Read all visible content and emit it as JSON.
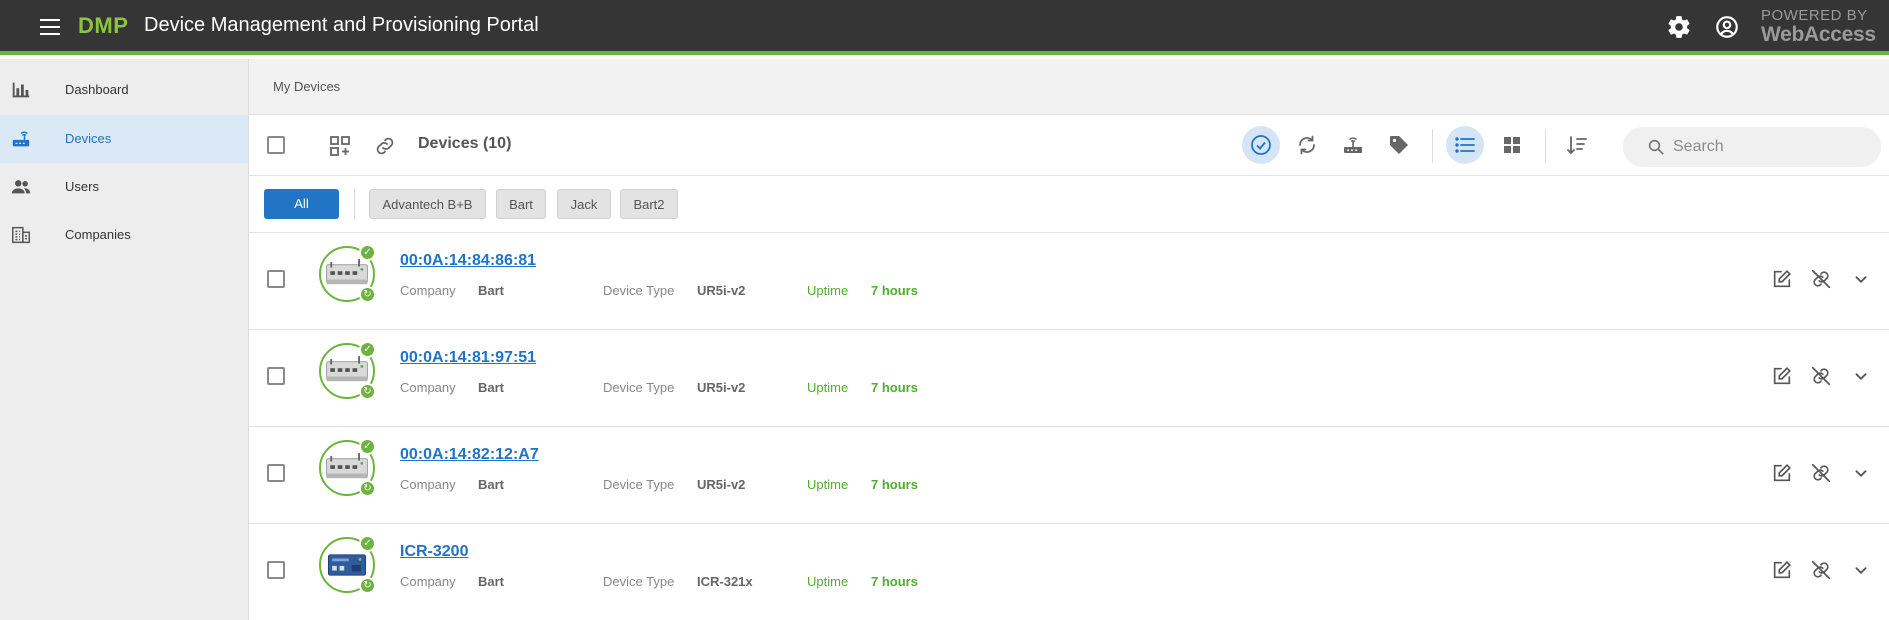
{
  "header": {
    "brand": "DMP",
    "title": "Device Management and Provisioning Portal",
    "powered_line1": "POWERED BY",
    "powered_line2": "WebAccess",
    "settings_icon": "gear-icon",
    "account_icon": "account-circle-icon",
    "accent_color": "#6db33f",
    "bar_color": "#353535"
  },
  "sidebar": {
    "items": [
      {
        "label": "Dashboard",
        "icon": "bar-chart-icon"
      },
      {
        "label": "Devices",
        "icon": "router-icon",
        "active": true
      },
      {
        "label": "Users",
        "icon": "users-icon"
      },
      {
        "label": "Companies",
        "icon": "building-icon"
      }
    ]
  },
  "breadcrumb": "My Devices",
  "toolbar": {
    "title": "Devices (10)",
    "search_placeholder": "Search",
    "icons": [
      "add-grid-icon",
      "link-icon",
      "check-circle-icon",
      "sync-icon",
      "router-icon",
      "tag-icon",
      "list-view-icon",
      "grid-view-icon",
      "sort-icon",
      "search-icon"
    ]
  },
  "filters": {
    "all": "All",
    "tags": [
      "Advantech B+B",
      "Bart",
      "Jack",
      "Bart2"
    ]
  },
  "labels": {
    "company": "Company",
    "device_type": "Device Type",
    "uptime": "Uptime"
  },
  "devices": [
    {
      "name": "00:0A:14:84:86:81",
      "company": "Bart",
      "device_type": "UR5i-v2",
      "uptime": "7 hours"
    },
    {
      "name": "00:0A:14:81:97:51",
      "company": "Bart",
      "device_type": "UR5i-v2",
      "uptime": "7 hours"
    },
    {
      "name": "00:0A:14:82:12:A7",
      "company": "Bart",
      "device_type": "UR5i-v2",
      "uptime": "7 hours"
    },
    {
      "name": "ICR-3200",
      "company": "Bart",
      "device_type": "ICR-321x",
      "uptime": "7 hours"
    }
  ]
}
